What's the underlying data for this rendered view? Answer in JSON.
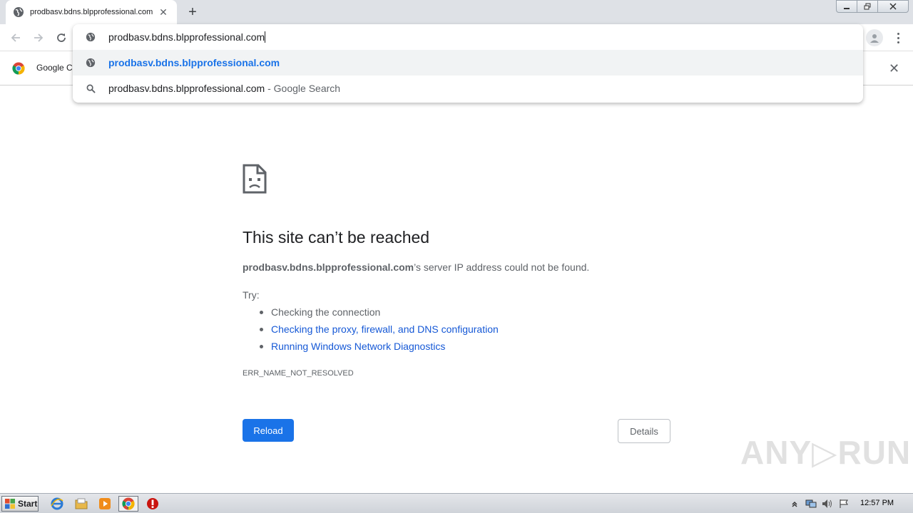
{
  "browser": {
    "tab": {
      "title": "prodbasv.bdns.blpprofessional.com",
      "close_glyph": "✕",
      "icon": "globe-icon"
    },
    "new_tab_glyph": "+",
    "window_controls": [
      "minimize-icon",
      "restore-icon",
      "close-icon"
    ],
    "nav": {
      "back": "back-arrow-icon",
      "forward": "forward-arrow-icon",
      "reload": "reload-icon"
    },
    "omnibox": {
      "input_value": "prodbasv.bdns.blpprofessional.com",
      "suggestions": [
        {
          "text": "prodbasv.bdns.blpprofessional.com",
          "icon": "globe-icon"
        },
        {
          "query": "prodbasv.bdns.blpprofessional.com",
          "separator": " - ",
          "suffix": "Google Search",
          "icon": "search-icon"
        }
      ]
    },
    "infobar": {
      "text": "Google Chrome isn't your default browser",
      "close_glyph": "✕",
      "icon": "chrome-logo"
    }
  },
  "error_page": {
    "title": "This site can’t be reached",
    "host": "prodbasv.bdns.blpprofessional.com",
    "desc_suffix": "’s server IP address could not be found.",
    "try_label": "Try:",
    "suggestions": [
      "Checking the connection",
      "Checking the proxy, firewall, and DNS configuration",
      "Running Windows Network Diagnostics"
    ],
    "error_code": "ERR_NAME_NOT_RESOLVED",
    "reload_label": "Reload",
    "details_label": "Details"
  },
  "watermark": "ANY▷RUN",
  "taskbar": {
    "start_label": "Start",
    "clock": "12:57 PM"
  },
  "colors": {
    "accent": "#1a73e8",
    "link": "#1558d6",
    "tabstrip": "#dee1e6"
  }
}
